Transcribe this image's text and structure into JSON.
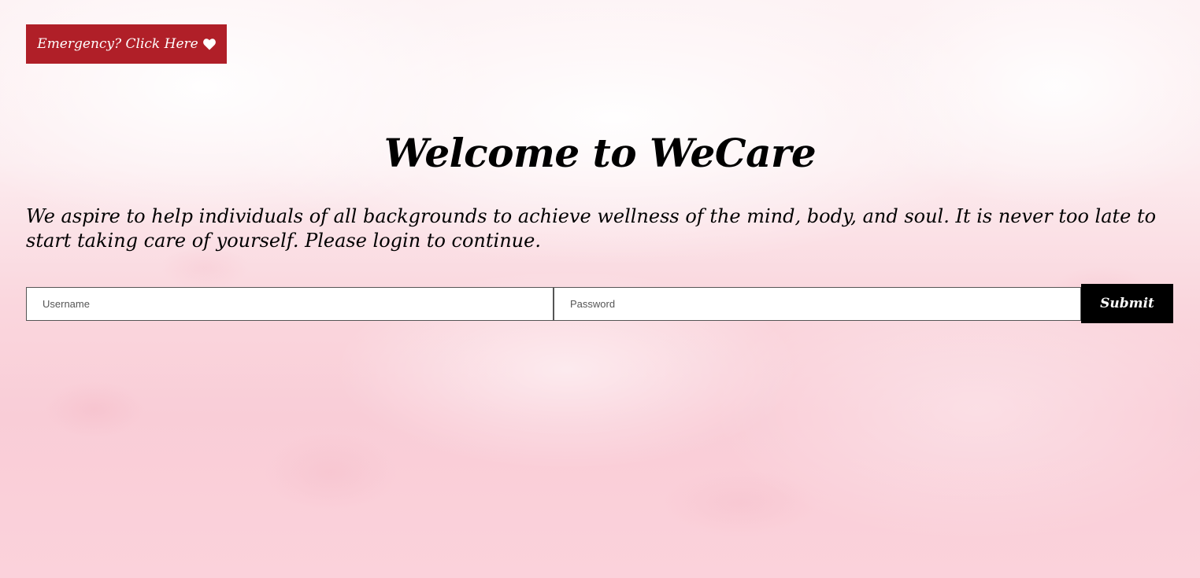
{
  "emergency_button": {
    "label": "Emergency? Click Here",
    "icon": "heart-icon",
    "background": "#b01f28"
  },
  "header": {
    "title": "Welcome to WeCare"
  },
  "intro": {
    "text": "We aspire to help individuals of all backgrounds to achieve wellness of the mind, body, and soul. It is never too late to start taking care of yourself. Please login to continue."
  },
  "login_form": {
    "username_placeholder": "Username",
    "username_value": "",
    "password_placeholder": "Password",
    "password_value": "",
    "submit_label": "Submit"
  },
  "colors": {
    "accent": "#b01f28",
    "submit_background": "#000000",
    "background_tint": "#f9cdd7"
  }
}
